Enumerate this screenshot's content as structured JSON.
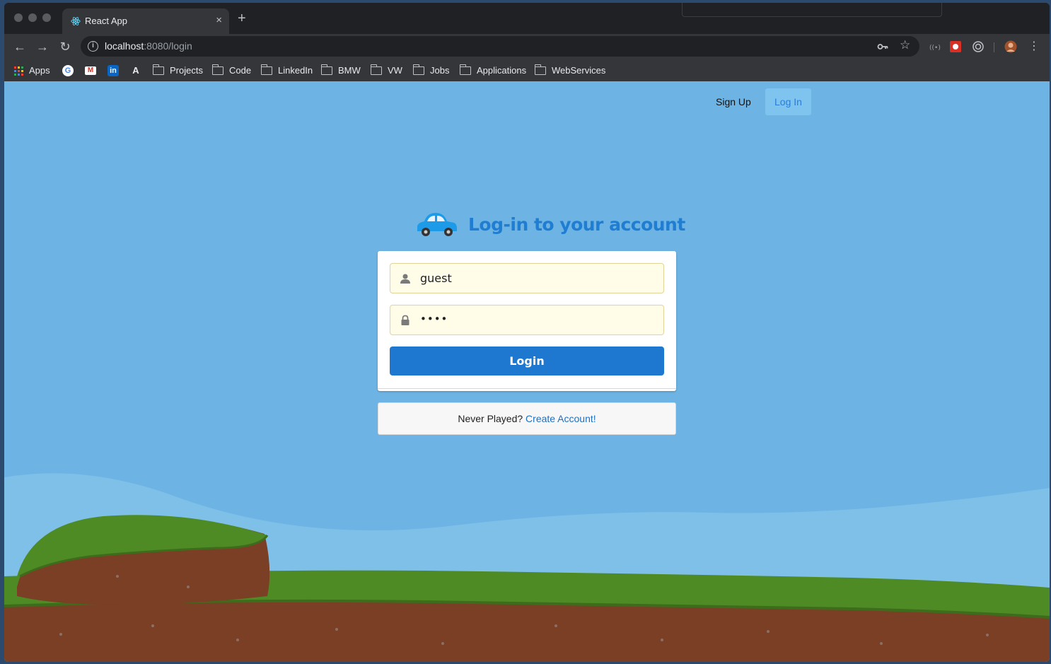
{
  "browser": {
    "tab_title": "React App",
    "tab_close": "×",
    "new_tab": "+",
    "url_host": "localhost",
    "url_path": ":8080/login"
  },
  "bookmarks": [
    {
      "label": "Apps",
      "icon": "apps-grid-icon"
    },
    {
      "label": "",
      "icon": "google-icon"
    },
    {
      "label": "",
      "icon": "gmail-icon"
    },
    {
      "label": "",
      "icon": "linkedin-icon"
    },
    {
      "label": "",
      "icon": "a-icon"
    },
    {
      "label": "Projects",
      "icon": "folder-icon"
    },
    {
      "label": "Code",
      "icon": "folder-icon"
    },
    {
      "label": "LinkedIn",
      "icon": "folder-icon"
    },
    {
      "label": "BMW",
      "icon": "folder-icon"
    },
    {
      "label": "VW",
      "icon": "folder-icon"
    },
    {
      "label": "Jobs",
      "icon": "folder-icon"
    },
    {
      "label": "Applications",
      "icon": "folder-icon"
    },
    {
      "label": "WebServices",
      "icon": "folder-icon"
    }
  ],
  "nav": {
    "signup": "Sign Up",
    "login": "Log In"
  },
  "login": {
    "heading": "Log-in to your account",
    "username_value": "guest",
    "password_value": "••••",
    "submit_label": "Login",
    "message_prefix": "Never Played?",
    "message_link": "Create Account!"
  },
  "colors": {
    "sky": "#6db3e3",
    "primary": "#1f78cf",
    "heading": "#1f7dd2",
    "grass": "#4f8b25",
    "dirt": "#7a3f24"
  }
}
